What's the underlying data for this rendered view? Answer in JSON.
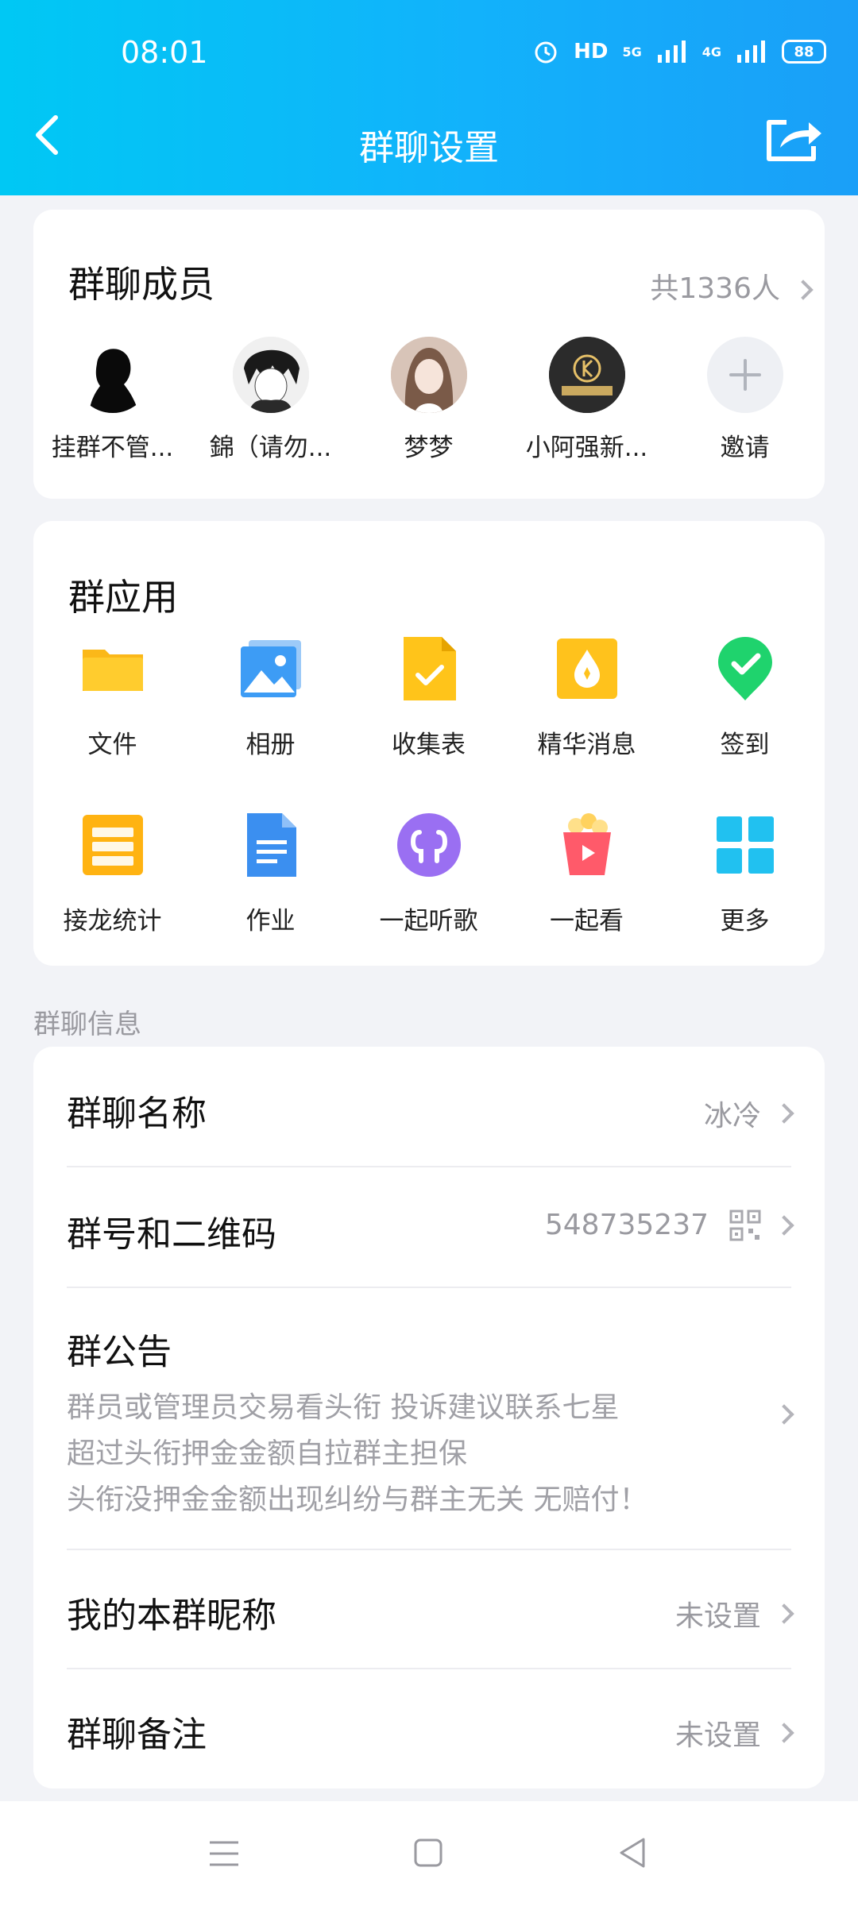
{
  "status_bar": {
    "time": "08:01",
    "network": "HD",
    "signal_5g": "5G",
    "signal_4g": "4G",
    "battery": "88"
  },
  "header": {
    "title": "群聊设置"
  },
  "members": {
    "title": "群聊成员",
    "count": "共1336人",
    "list": [
      {
        "name": "挂群不管..."
      },
      {
        "name": "錦（请勿..."
      },
      {
        "name": "梦梦"
      },
      {
        "name": "小阿强新..."
      },
      {
        "name": "邀请"
      }
    ]
  },
  "apps": {
    "title": "群应用",
    "items": [
      {
        "label": "文件",
        "icon": "folder-icon"
      },
      {
        "label": "相册",
        "icon": "album-icon"
      },
      {
        "label": "收集表",
        "icon": "form-icon"
      },
      {
        "label": "精华消息",
        "icon": "essence-icon"
      },
      {
        "label": "签到",
        "icon": "checkin-icon"
      },
      {
        "label": "接龙统计",
        "icon": "chain-icon"
      },
      {
        "label": "作业",
        "icon": "homework-icon"
      },
      {
        "label": "一起听歌",
        "icon": "music-icon"
      },
      {
        "label": "一起看",
        "icon": "watch-icon"
      },
      {
        "label": "更多",
        "icon": "more-icon"
      }
    ]
  },
  "info": {
    "section_label": "群聊信息",
    "group_name_label": "群聊名称",
    "group_name_value": "冰冷",
    "group_id_label": "群号和二维码",
    "group_id_value": "548735237",
    "announcement_label": "群公告",
    "announcement_lines": [
      "群员或管理员交易看头衔 投诉建议联系七星",
      "超过头衔押金金额自拉群主担保",
      "头衔没押金金额出现纠纷与群主无关 无赔付！"
    ],
    "nickname_label": "我的本群昵称",
    "nickname_value": "未设置",
    "remark_label": "群聊备注",
    "remark_value": "未设置"
  },
  "colors": {
    "header_start": "#00c8f4",
    "header_end": "#1a9ff8",
    "secondary_text": "#9a9aa0"
  }
}
